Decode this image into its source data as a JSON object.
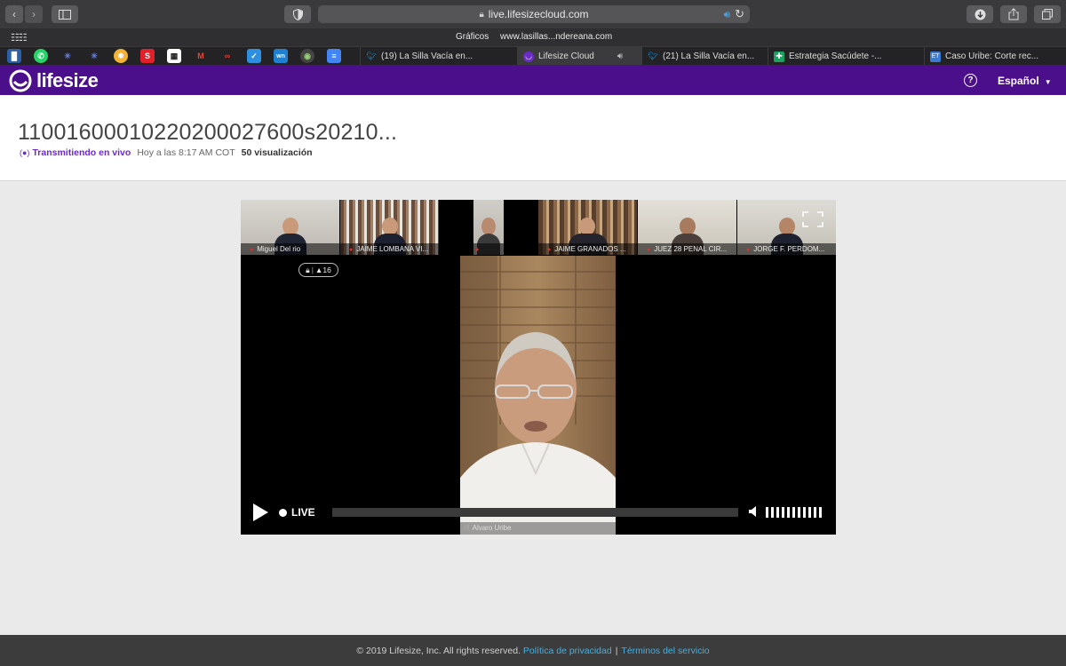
{
  "browser": {
    "url": "live.lifesizecloud.com",
    "favorites": [
      "Gráficos",
      "www.lasillas...ndereana.com"
    ],
    "tabs": [
      {
        "title": "(19) La Silla Vacía en...",
        "icon": "twitter-icon"
      },
      {
        "title": "Lifesize Cloud",
        "icon": "lifesize-icon",
        "active": true
      },
      {
        "title": "(21) La Silla Vacía en...",
        "icon": "twitter-icon"
      },
      {
        "title": "Estrategia Sacúdete -...",
        "icon": "sheets-icon"
      },
      {
        "title": "Caso Uribe: Corte rec...",
        "icon": "et-icon"
      }
    ]
  },
  "header": {
    "brand": "lifesize",
    "language": "Español"
  },
  "event": {
    "title": "11001600010220200027600s20210...",
    "live_status": "Transmitiendo en vivo",
    "time": "Hoy a las 8:17 AM COT",
    "views": "50 visualización"
  },
  "player": {
    "participants": [
      {
        "name": "Miguel Del rio"
      },
      {
        "name": "JAIME LOMBANA VI..."
      },
      {
        "name": ""
      },
      {
        "name": "JAIME GRANADOS ..."
      },
      {
        "name": "JUEZ 28 PENAL CIR..."
      },
      {
        "name": "JORGE F. PERDOM..."
      }
    ],
    "participant_count": "16",
    "main_speaker": "Alvaro Uribe",
    "live_label": "LIVE"
  },
  "footer": {
    "copyright": "© 2019 Lifesize, Inc. All rights reserved.",
    "privacy": "Política de privacidad",
    "separator": "|",
    "terms": "Términos del servicio"
  },
  "colors": {
    "brand_purple": "#4b0f8c",
    "live_purple": "#6a2bc7",
    "link_blue": "#3fb2e8"
  }
}
